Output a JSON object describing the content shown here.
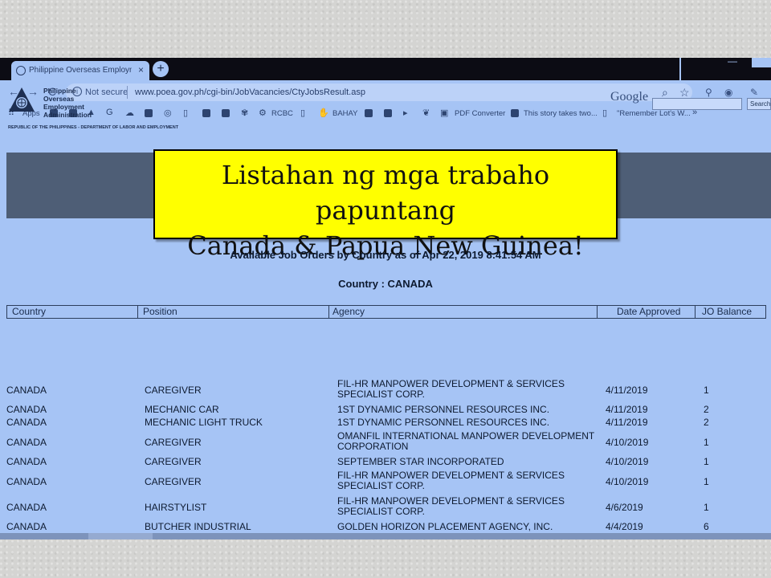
{
  "browser": {
    "tab_title": "Philippine Overseas Employment",
    "tab_close": "×",
    "new_tab": "+",
    "not_secure": "Not secure",
    "url": "www.poea.gov.ph/cgi-bin/JobVacancies/CtyJobsResult.asp",
    "back": "←",
    "forward": "→",
    "reload": "C",
    "zoom_icon": "⌕",
    "star_icon": "☆",
    "bookmarks": {
      "apps": "Apps",
      "rcbc": "RCBC",
      "bahay": "BAHAY",
      "pdf": "PDF Converter",
      "story": "This story takes two...",
      "remember": "\"Remember Lot's W..."
    }
  },
  "page": {
    "logo_lines": [
      "Philippine",
      "Overseas",
      "Employment",
      "Administration"
    ],
    "logo_subtitle": "REPUBLIC OF THE PHILIPPINES - DEPARTMENT OF LABOR AND EMPLOYMENT",
    "google_label": "Google",
    "search_button": "Search",
    "banner_line1": "Listahan ng mga trabaho papuntang",
    "banner_line2": "Canada & Papua New Guinea!",
    "available_heading": "Available Job Orders by Country as of Apr 22, 2019 8:41:54 AM",
    "country_heading": "Country : CANADA"
  },
  "table": {
    "headers": [
      "Country",
      "Position",
      "Agency",
      "Date Approved",
      "JO Balance"
    ],
    "rows": [
      {
        "country": "CANADA",
        "position": "CAREGIVER",
        "agency": [
          "FIL-HR MANPOWER DEVELOPMENT & SERVICES",
          "SPECIALIST CORP."
        ],
        "date": "4/11/2019",
        "balance": "1"
      },
      {
        "country": "CANADA",
        "position": "MECHANIC CAR",
        "agency": [
          "1ST DYNAMIC PERSONNEL RESOURCES INC."
        ],
        "date": "4/11/2019",
        "balance": "2"
      },
      {
        "country": "CANADA",
        "position": "MECHANIC LIGHT TRUCK",
        "agency": [
          "1ST DYNAMIC PERSONNEL RESOURCES INC."
        ],
        "date": "4/11/2019",
        "balance": "2"
      },
      {
        "country": "CANADA",
        "position": "CAREGIVER",
        "agency": [
          "OMANFIL INTERNATIONAL MANPOWER DEVELOPMENT",
          "CORPORATION"
        ],
        "date": "4/10/2019",
        "balance": "1"
      },
      {
        "country": "CANADA",
        "position": "CAREGIVER",
        "agency": [
          "SEPTEMBER STAR INCORPORATED"
        ],
        "date": "4/10/2019",
        "balance": "1"
      },
      {
        "country": "CANADA",
        "position": "CAREGIVER",
        "agency": [
          "FIL-HR MANPOWER DEVELOPMENT & SERVICES",
          "SPECIALIST CORP."
        ],
        "date": "4/10/2019",
        "balance": "1"
      },
      {
        "country": "CANADA",
        "position": "HAIRSTYLIST",
        "agency": [
          "FIL-HR MANPOWER DEVELOPMENT & SERVICES",
          "SPECIALIST CORP."
        ],
        "date": "4/6/2019",
        "balance": "1"
      },
      {
        "country": "CANADA",
        "position": "BUTCHER INDUSTRIAL",
        "agency": [
          "GOLDEN HORIZON PLACEMENT AGENCY, INC."
        ],
        "date": "4/4/2019",
        "balance": "6"
      }
    ]
  }
}
